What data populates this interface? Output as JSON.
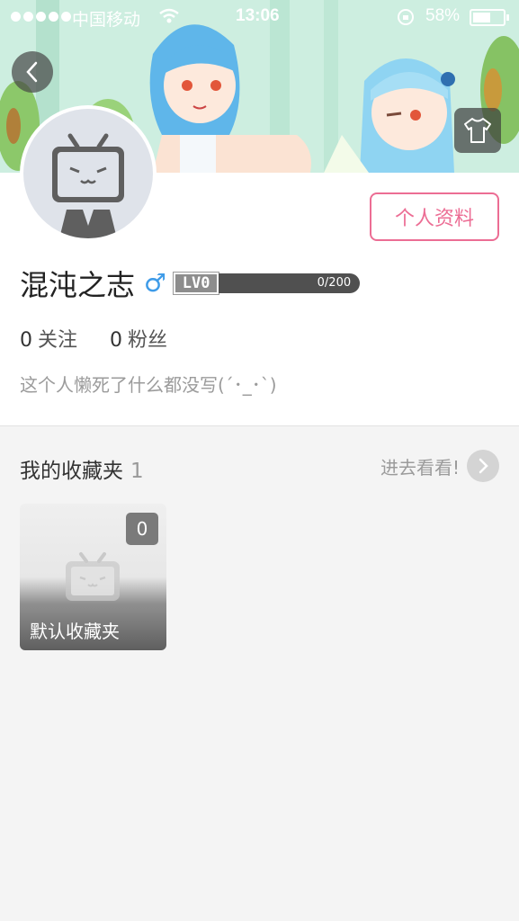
{
  "status_bar": {
    "carrier": "中国移动",
    "time": "13:06",
    "battery_pct": "58%",
    "battery_level": 0.58
  },
  "profile": {
    "edit_button_label": "个人资料",
    "username": "混沌之志",
    "gender_symbol": "♂",
    "level": "LV0",
    "exp_text": "0/200",
    "exp_progress": 0,
    "following_count": "0",
    "following_label": "关注",
    "followers_count": "0",
    "followers_label": "粉丝",
    "signature": "这个人懒死了什么都没写(´･_･`)"
  },
  "favorites": {
    "title": "我的收藏夹",
    "count": "1",
    "more_label": "进去看看!",
    "folders": [
      {
        "name": "默认收藏夹",
        "item_count": "0"
      }
    ]
  },
  "colors": {
    "accent_pink": "#ec6d94",
    "gender_blue": "#3e9be8",
    "page_bg": "#f4f4f4"
  }
}
